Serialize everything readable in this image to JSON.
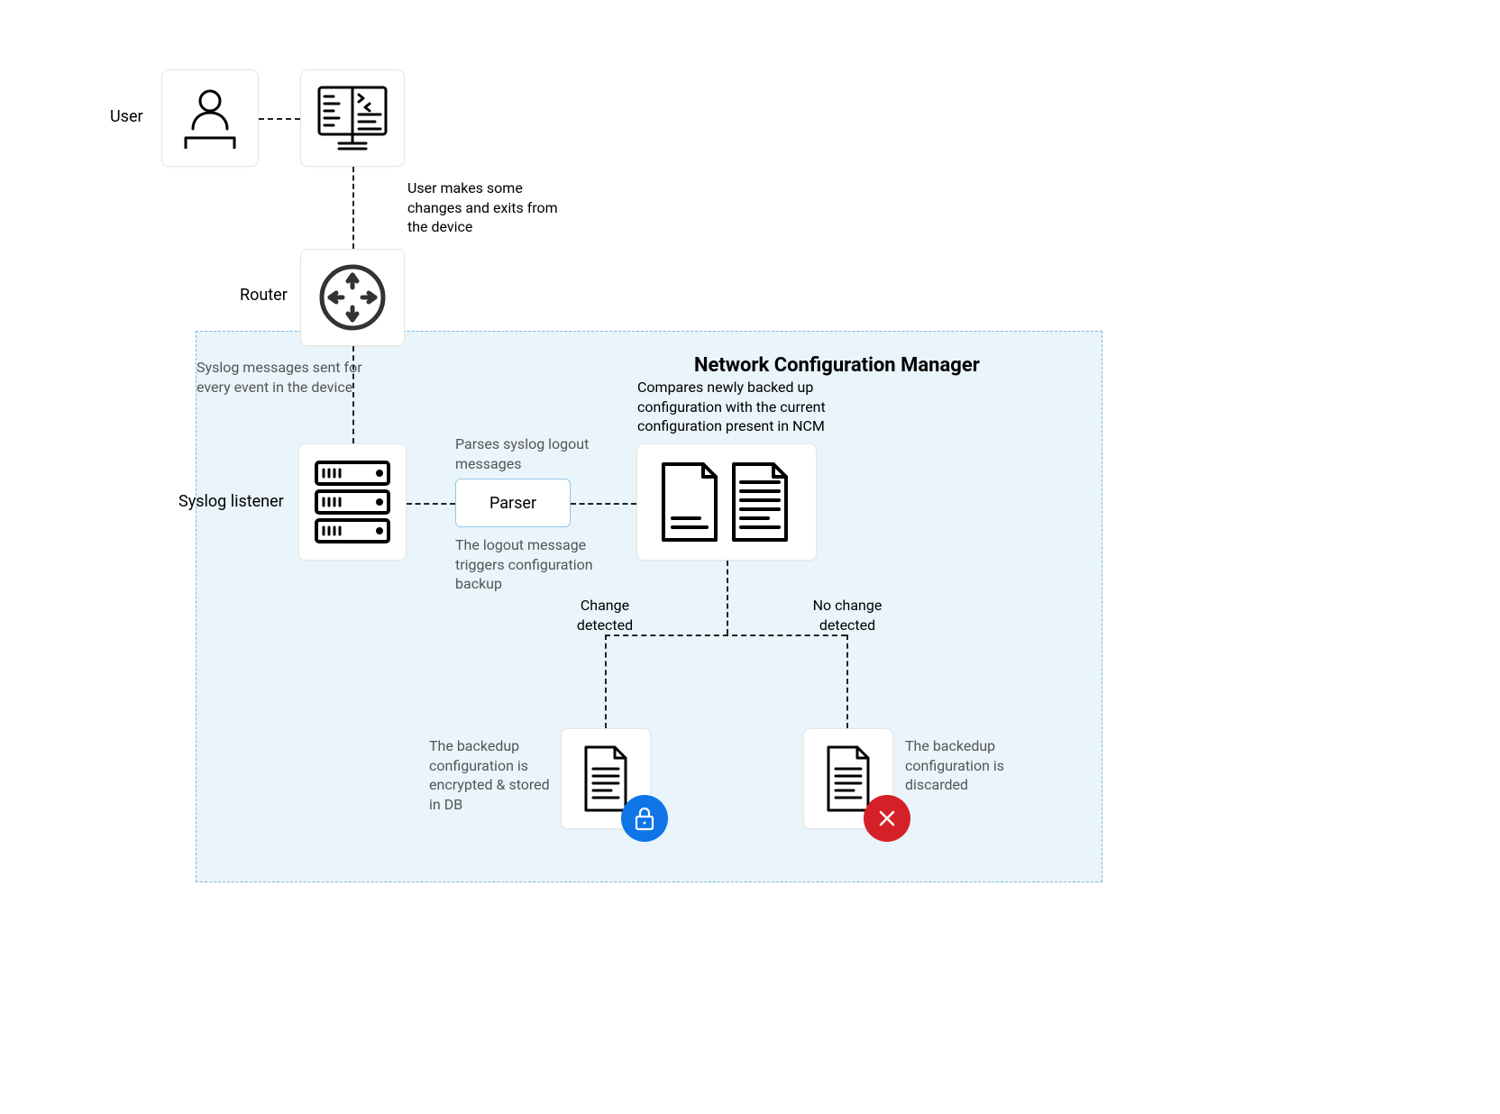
{
  "labels": {
    "user": "User",
    "router": "Router",
    "syslog_listener": "Syslog listener",
    "parser": "Parser",
    "ncm_title": "Network Configuration Manager"
  },
  "captions": {
    "user_changes": "User makes some changes and exits from the device",
    "syslog_sent": "Syslog messages sent for every event in the device",
    "parses_syslog": "Parses syslog logout messages",
    "logout_triggers": "The logout message triggers configuration backup",
    "compare": "Compares newly backed up configuration with the current configuration present in NCM",
    "change_detected": "Change detected",
    "no_change_detected": "No change detected",
    "encrypted_stored": "The backedup configuration is encrypted & stored in DB",
    "discarded": "The backedup configuration is discarded"
  },
  "colors": {
    "ncm_bg": "#e9f4fb",
    "ncm_border": "#7cb9e0",
    "blue_badge": "#0f74e8",
    "red_badge": "#d62027"
  }
}
